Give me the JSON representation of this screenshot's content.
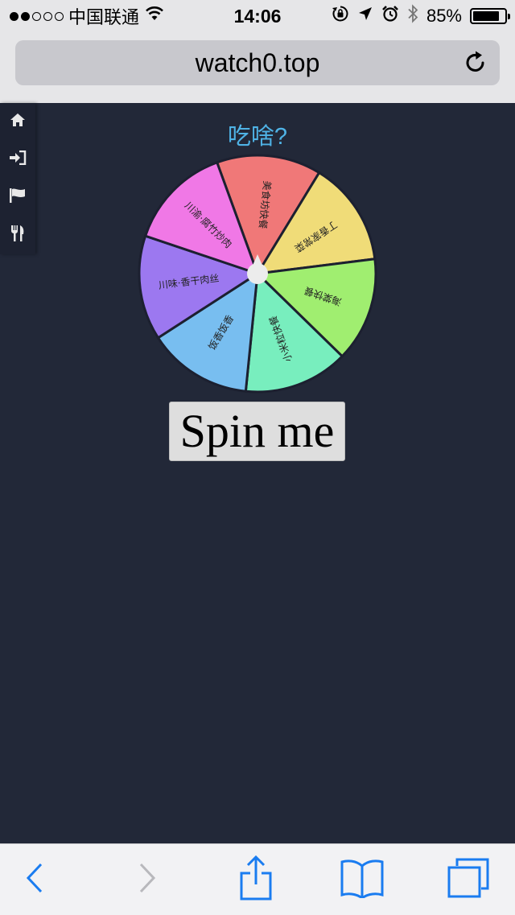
{
  "status_bar": {
    "signal_dots_on": 2,
    "signal_dots_total": 5,
    "carrier": "中国联通",
    "time": "14:06",
    "battery": "85%",
    "battery_level": 0.85
  },
  "browser": {
    "url": "watch0.top"
  },
  "sidenav": {
    "items": [
      {
        "icon": "home-icon"
      },
      {
        "icon": "sign-in-icon"
      },
      {
        "icon": "flag-icon"
      },
      {
        "icon": "utensils-icon"
      }
    ]
  },
  "page": {
    "title": "吃啥?",
    "spin_label": "Spin me"
  },
  "wheel": {
    "segments": [
      {
        "label": "美食坊快餐",
        "color": "#f07878"
      },
      {
        "label": "丁香家常菜",
        "color": "#f0dc78"
      },
      {
        "label": "海棠快餐",
        "color": "#a0ee70"
      },
      {
        "label": "小米粒快餐",
        "color": "#78eebe"
      },
      {
        "label": "饭香饭香",
        "color": "#78bef0"
      },
      {
        "label": "川味·香干肉丝",
        "color": "#9c78f0"
      },
      {
        "label": "川渝·腐竹炒肉",
        "color": "#f078e6"
      }
    ]
  },
  "colors": {
    "background": "#222838",
    "accent": "#4fb3e6",
    "ios_blue": "#1a7cf0"
  }
}
